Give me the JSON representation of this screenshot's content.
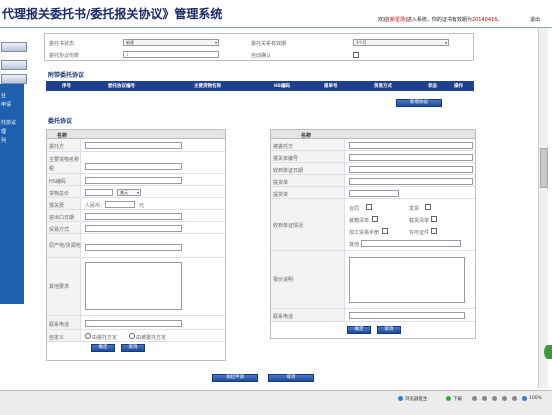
{
  "header": {
    "title": "代理报关委托书/委托报关协议》管理系统",
    "welcome_prefix": "欢迎",
    "user": "[新星场]",
    "welcome_mid": "进入系统，你的证书有效期为",
    "expiry": "20140416",
    "welcome_suffix": "。",
    "logout": "退出"
  },
  "sidebar": {
    "items": [
      "业",
      "申请",
      "",
      "托协议",
      "理",
      "列"
    ]
  },
  "topform": {
    "state_label": "委托书状态",
    "state_value": "新建",
    "relation_label": "委托关系有效期",
    "relation_value": "3个月",
    "count_label": "委托协议份数",
    "count_value": "1",
    "auto_label": "自动确认"
  },
  "attach": {
    "title": "附带委托协议",
    "headers": [
      "序号",
      "委托协议编号",
      "主要货物名称",
      "HS编码",
      "报单号",
      "贸易方式",
      "状态",
      "操作"
    ],
    "add_button": "新增协议"
  },
  "agreement": {
    "title": "委托协议"
  },
  "left": {
    "head": "名称",
    "rows": [
      "委托方",
      "主要货物名称",
      "税",
      "HS编码",
      "货物总价",
      "报关费",
      "进出口日期",
      "贸易方式",
      "原产地/货源地",
      "其他要求",
      "联系电话",
      "自定义"
    ],
    "currency": "美元",
    "price_unit": "人民币：",
    "yuan": "元",
    "radio1": "由委托方定",
    "radio2": "由被委托方定",
    "ok": "确定",
    "cancel": "取消"
  },
  "right": {
    "head": "名称",
    "rows": [
      "被委托方",
      "报关单编号",
      "收到单证日期",
      "提货单",
      "提货单",
      "收到单证情况",
      "",
      "",
      "",
      "报价说明",
      "联系电话"
    ],
    "checks": [
      "合同",
      "发票",
      "装箱清单",
      "载货清单",
      "加工贸易手册",
      "许可证件",
      "其他"
    ],
    "ok": "确定",
    "cancel": "取消"
  },
  "footer": {
    "submit": "发起申请",
    "cancel": "取消"
  },
  "statusbar": {
    "browser": "浏览器医生",
    "download": "下载",
    "zoom": "100%"
  }
}
